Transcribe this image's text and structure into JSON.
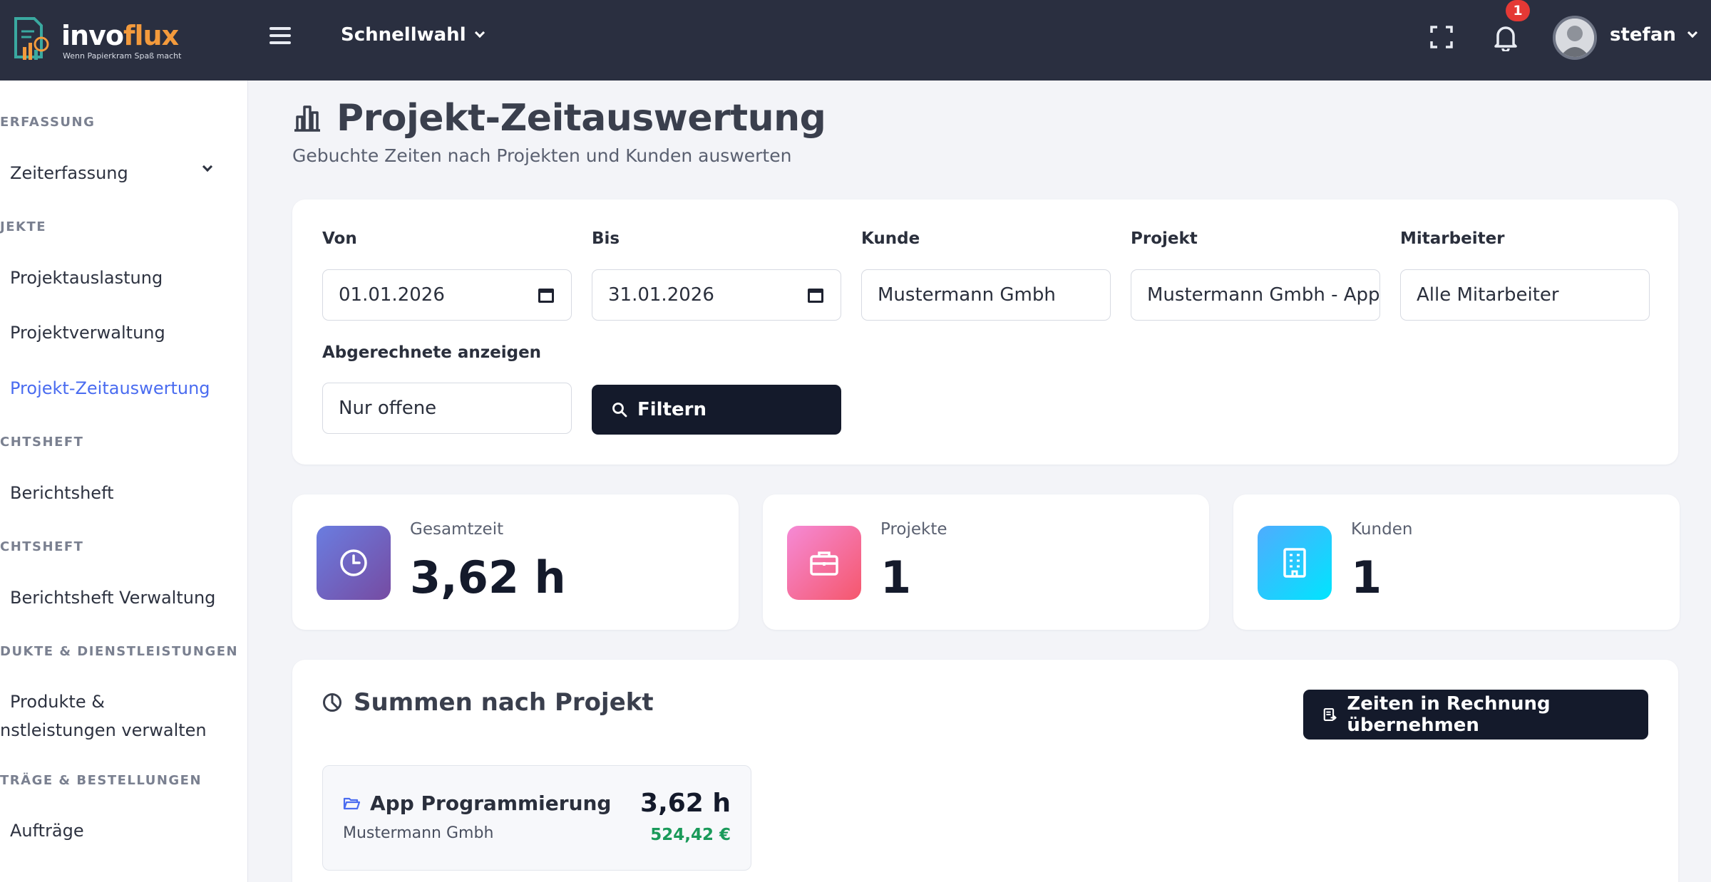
{
  "brand": {
    "name_part1": "invo",
    "name_part2": "flux",
    "tagline": "Wenn Papierkram Spaß macht"
  },
  "topbar": {
    "quick_select": "Schnellwahl",
    "notification_count": "1",
    "user_name": "stefan"
  },
  "sidebar": {
    "sections": [
      {
        "label": "ERFASSUNG",
        "items": [
          {
            "label": "Zeiterfassung"
          }
        ]
      },
      {
        "label": "JEKTE",
        "items": [
          {
            "label": "Projektauslastung"
          },
          {
            "label": "Projektverwaltung"
          },
          {
            "label": "Projekt-Zeitauswertung",
            "active": true
          }
        ]
      },
      {
        "label": "CHTSHEFT",
        "items": [
          {
            "label": "Berichtsheft"
          }
        ]
      },
      {
        "label": "CHTSHEFT",
        "items": [
          {
            "label": "Berichtsheft Verwaltung"
          }
        ]
      },
      {
        "label": "DUKTE & DIENSTLEISTUNGEN",
        "items": [
          {
            "label_line1": "Produkte &",
            "label_line2": "nstleistungen verwalten"
          }
        ]
      },
      {
        "label": "TRÄGE & BESTELLUNGEN",
        "items": [
          {
            "label": "Aufträge"
          }
        ]
      }
    ]
  },
  "page": {
    "title": "Projekt-Zeitauswertung",
    "subtitle": "Gebuchte Zeiten nach Projekten und Kunden auswerten"
  },
  "filters": {
    "von": {
      "label": "Von",
      "value": "01.01.2026"
    },
    "bis": {
      "label": "Bis",
      "value": "31.01.2026"
    },
    "kunde": {
      "label": "Kunde",
      "value": "Mustermann Gmbh"
    },
    "projekt": {
      "label": "Projekt",
      "value": "Mustermann Gmbh - App Programmierung"
    },
    "mitarbeiter": {
      "label": "Mitarbeiter",
      "value": "Alle Mitarbeiter"
    },
    "abgerechnete": {
      "label": "Abgerechnete anzeigen",
      "value": "Nur offene"
    },
    "filter_button": "Filtern"
  },
  "stats": [
    {
      "label": "Gesamtzeit",
      "value": "3,62 h",
      "icon": "clock-icon",
      "gradient": [
        "#6a7de0",
        "#764ba2"
      ]
    },
    {
      "label": "Projekte",
      "value": "1",
      "icon": "briefcase-icon",
      "gradient": [
        "#f58ad6",
        "#f5576c"
      ]
    },
    {
      "label": "Kunden",
      "value": "1",
      "icon": "building-icon",
      "gradient": [
        "#4facfe",
        "#00e5fe"
      ]
    }
  ],
  "summary": {
    "title": "Summen nach Projekt",
    "transfer_button": "Zeiten in Rechnung übernehmen",
    "projects": [
      {
        "name": "App Programmierung",
        "customer": "Mustermann Gmbh",
        "hours": "3,62 h",
        "amount": "524,42 €"
      }
    ]
  },
  "colors": {
    "topbar": "#2a2f40",
    "accent": "#4a6cf0",
    "button_dark": "#141a2b",
    "money_green": "#1a9a5a"
  }
}
